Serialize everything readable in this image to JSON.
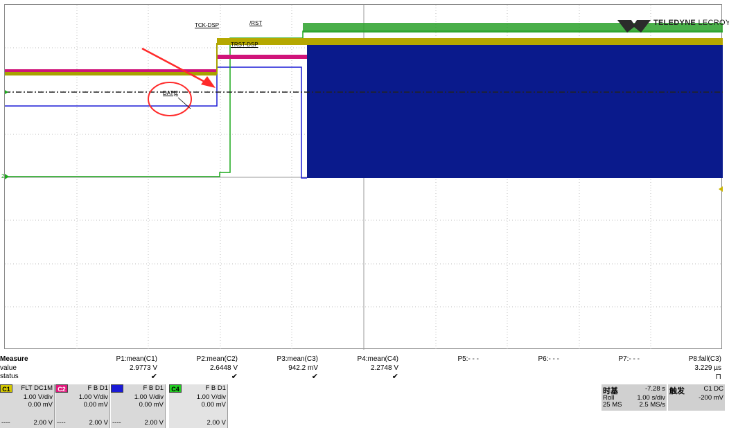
{
  "logo": {
    "brand": "TELEDYNE",
    "brand2": "LECROY"
  },
  "trace_labels": {
    "tck": "TCK-DSP",
    "rst": "/RST",
    "trst": "TRST-DSP",
    "dat": "DAT[2"
  },
  "channel_markers": {
    "left_c2": "2"
  },
  "measure": {
    "title": "Measure",
    "row_value": "value",
    "row_status": "status",
    "params": [
      {
        "name": "P1:mean(C1)",
        "value": "2.9773 V",
        "status": "✔"
      },
      {
        "name": "P2:mean(C2)",
        "value": "2.6448 V",
        "status": "✔"
      },
      {
        "name": "P3:mean(C3)",
        "value": "942.2 mV",
        "status": "✔"
      },
      {
        "name": "P4:mean(C4)",
        "value": "2.2748 V",
        "status": "✔"
      },
      {
        "name": "P5:- - -",
        "value": "",
        "status": ""
      },
      {
        "name": "P6:- - -",
        "value": "",
        "status": ""
      },
      {
        "name": "P7:- - -",
        "value": "",
        "status": ""
      },
      {
        "name": "P8:fall(C3)",
        "value": "3.229 µs",
        "status": "⊓"
      }
    ]
  },
  "channels": [
    {
      "tag": "C1",
      "coupling": "FLT  DC1M",
      "vdiv": "1.00 V/div",
      "offset": "0.00 mV",
      "bottom": "2.00 V",
      "dash": "----",
      "color": "#d4c800"
    },
    {
      "tag": "C2",
      "coupling": "F  B  D1",
      "vdiv": "1.00 V/div",
      "offset": "0.00 mV",
      "bottom": "2.00 V",
      "dash": "----",
      "color": "#e0177b"
    },
    {
      "tag": "C3",
      "coupling": "F  B  D1",
      "vdiv": "1.00 V/div",
      "offset": "0.00 mV",
      "bottom": "2.00 V",
      "dash": "----",
      "color": "#1a1ad6"
    },
    {
      "tag": "C4",
      "coupling": "F  B  D1",
      "vdiv": "1.00 V/div",
      "offset": "0.00 mV",
      "bottom": "2.00 V",
      "dash": "",
      "color": "#22cc22"
    }
  ],
  "timebase": {
    "title": "时基",
    "delay": "-7.28 s",
    "mode": "Roll",
    "tdiv": "1.00 s/div",
    "samples": "25 MS",
    "rate": "2.5 MS/s"
  },
  "trigger": {
    "title": "触发",
    "source": "C1 DC",
    "level": "-200 mV"
  },
  "colors": {
    "c1": "#c8b400",
    "c2": "#e0177b",
    "c3": "#0a1a8c",
    "c4": "#1aa81a",
    "annotation": "#ff2a2a"
  }
}
